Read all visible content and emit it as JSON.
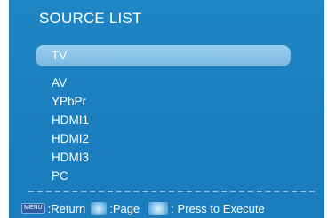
{
  "title": "SOURCE LIST",
  "sources": [
    "TV",
    "AV",
    "YPbPr",
    "HDMI1",
    "HDMI2",
    "HDMI3",
    "PC"
  ],
  "selected_index": 0,
  "footer": {
    "menu_key": "MENU",
    "return_label": ":Return",
    "page_icon": "up-down-arrows-icon",
    "page_label": ":Page",
    "execute_icon": "ok-button-icon",
    "execute_label": ": Press to Execute"
  },
  "colors": {
    "background": "#1b7fbf",
    "highlight": "#8cc4ea",
    "text": "#ffffff"
  }
}
